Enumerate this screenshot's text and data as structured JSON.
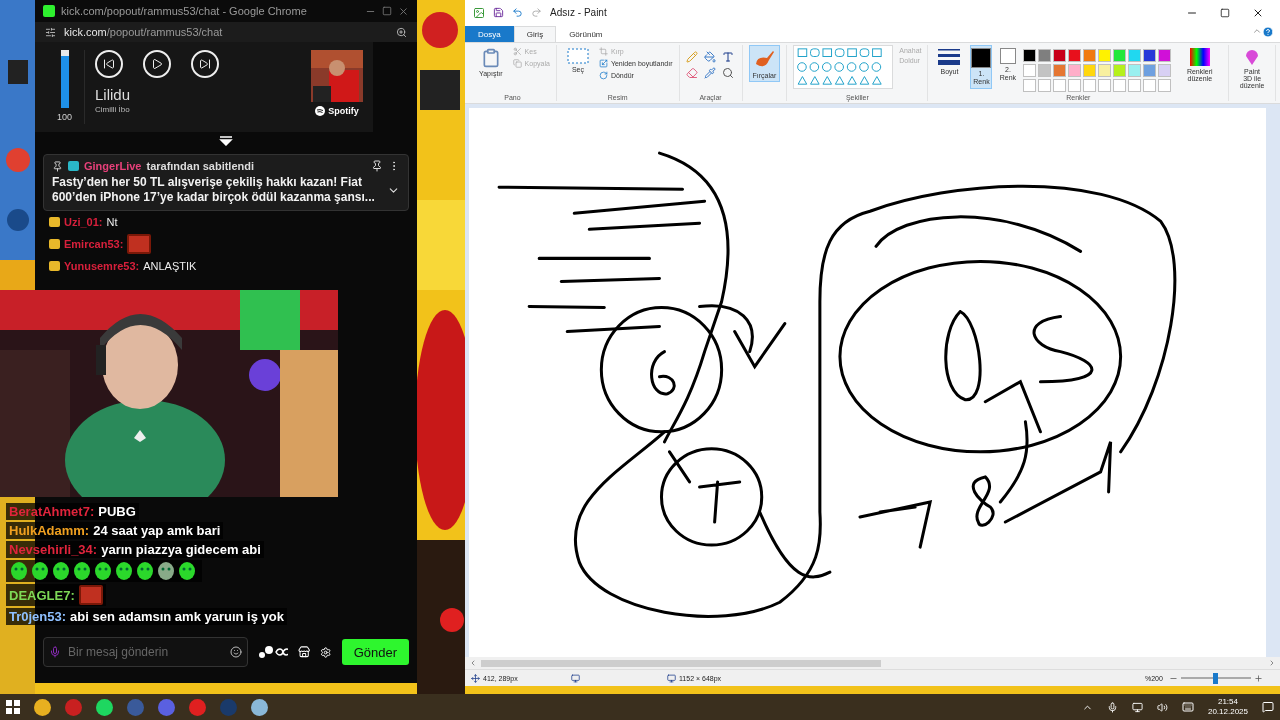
{
  "chrome": {
    "title": "kick.com/popout/rammus53/chat - Google Chrome",
    "url_host": "kick.com",
    "url_path": "/popout/rammus53/chat"
  },
  "media": {
    "level": 0.9,
    "volume": "100",
    "track": "Lilidu",
    "artist": "Cimilli İbo",
    "source": "Spotify"
  },
  "pinned": {
    "author": "GingerLive",
    "suffix": "tarafından sabitlendi",
    "message": "Fasty’den her 50 TL alışverişe çekiliş hakkı kazan! Fiat 600’den iPhone 17’ye kadar birçok ödül kazanma şansı..."
  },
  "chat": [
    {
      "kind": "text",
      "user": "Uzi_01:",
      "color": "#d8203c",
      "text": "Nt"
    },
    {
      "kind": "emote",
      "user": "Emircan53:",
      "color": "#d8203c"
    },
    {
      "kind": "text",
      "user": "Yunusemre53:",
      "color": "#d8203c",
      "text": "ANLAŞTIK"
    }
  ],
  "stream_chat": [
    {
      "kind": "text",
      "user": "BeratAhmet7:",
      "color": "#e0243c",
      "text": "PUBG"
    },
    {
      "kind": "text",
      "user": "HulkAdamm:",
      "color": "#f0a020",
      "text": "24 saat yap amk bari"
    },
    {
      "kind": "text_emotes",
      "user": "Nevsehirli_34:",
      "color": "#e0243c",
      "text": "yarın piazzya gidecem abi"
    },
    {
      "kind": "emote",
      "user": "DEAGLE7:",
      "color": "#7ed957"
    },
    {
      "kind": "text",
      "user": "Tr0jen53:",
      "color": "#8fc0ff",
      "text": "abi sen adamsın amk yaruın iş yok"
    }
  ],
  "chat_input": {
    "placeholder": "Bir mesaj gönderin",
    "send": "Gönder"
  },
  "paint": {
    "title": "Adsız - Paint",
    "tabs": [
      {
        "label": "Dosya",
        "kind": "file",
        "selected": false
      },
      {
        "label": "Giriş",
        "kind": "tab",
        "selected": true
      },
      {
        "label": "Görünüm",
        "kind": "tab",
        "selected": false
      }
    ],
    "clipboard": {
      "group": "Pano",
      "paste": "Yapıştır",
      "cut": "Kes",
      "copy": "Kopyala",
      "disabled": true
    },
    "image": {
      "group": "Resim",
      "select": "Seç",
      "crop": "Kırp",
      "crop_disabled": true,
      "resize": "Yeniden boyutlandır",
      "rotate": "Döndür"
    },
    "tools": {
      "group": "Araçlar"
    },
    "brushes": {
      "label": "Fırçalar",
      "selected": true
    },
    "shapes": {
      "group": "Şekiller",
      "outline": "Anahat",
      "fill": "Doldur",
      "disabled": true
    },
    "size": {
      "label": "Boyut"
    },
    "colors": [
      {
        "label": "1. Renk",
        "color": "#000000",
        "selected": true
      },
      {
        "label": "2. Renk",
        "color": "#ffffff",
        "selected": false
      }
    ],
    "palette": [
      {
        "color": "#000000"
      },
      {
        "color": "#7f7f7f"
      },
      {
        "color": "#c8001a"
      },
      {
        "color": "#e8101c"
      },
      {
        "color": "#f07a10"
      },
      {
        "color": "#fff200"
      },
      {
        "color": "#22e83a"
      },
      {
        "color": "#20d8f0"
      },
      {
        "color": "#2838d8"
      },
      {
        "color": "#d010d8"
      },
      {
        "color": "#ffffff"
      },
      {
        "color": "#c3c3c3"
      },
      {
        "color": "#e57632"
      },
      {
        "color": "#ffaec9"
      },
      {
        "color": "#ffd70e"
      },
      {
        "color": "#f8f0a0"
      },
      {
        "color": "#b5f01d"
      },
      {
        "color": "#99f0f0"
      },
      {
        "color": "#6fa0e0"
      },
      {
        "color": "#d8d0f4"
      }
    ],
    "edit_colors": "Renkleri düzenle",
    "colors_group": "Renkler",
    "paint3d": "Paint 3D ile düzenle",
    "status": {
      "cursor": "412, 289px",
      "size": "1152 × 648px",
      "zoom": "%200"
    },
    "zoom_slider": {
      "level": 0.5
    }
  },
  "taskbar": {
    "time": "21:54",
    "date": "20.12.2025"
  }
}
